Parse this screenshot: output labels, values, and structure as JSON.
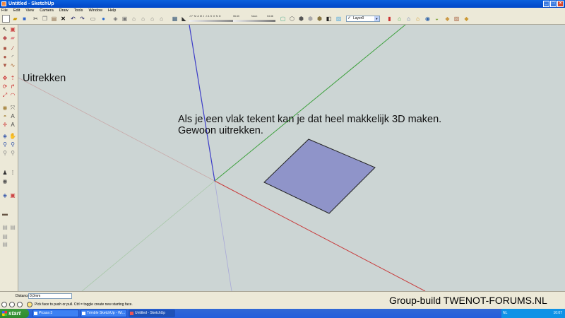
{
  "window": {
    "title": "Untitled - SketchUp"
  },
  "menu": [
    "File",
    "Edit",
    "View",
    "Camera",
    "Draw",
    "Tools",
    "Window",
    "Help"
  ],
  "shadow": {
    "months": "J F M A M J J A S O N D",
    "time_start": "06:43",
    "time_noon": "Noon",
    "time_end": "04:46"
  },
  "layer": {
    "current": "Layer0"
  },
  "viewport": {
    "label_tool": "Uitrekken",
    "caption_line1": "Als je een vlak tekent kan je dat heel makkelijk 3D maken.",
    "caption_line2": "Gewoon uitrekken.",
    "face_color": "#8f94c9",
    "axis_red": "#c83c3c",
    "axis_green": "#3ca03c",
    "axis_blue": "#3c3cc8"
  },
  "measurements": {
    "label": "Distance",
    "value": "0,0mm"
  },
  "status": {
    "hint": "Pick face to push or pull.  Ctrl = toggle create new starting face."
  },
  "watermark": "Group-build TWENOT-FORUMS.NL",
  "taskbar": {
    "start": "start",
    "tasks": [
      "Picasa 3",
      "Trimble SketchUp - Wi...",
      "Untitled - SketchUp"
    ],
    "language": "NL",
    "clock": "10:07"
  }
}
